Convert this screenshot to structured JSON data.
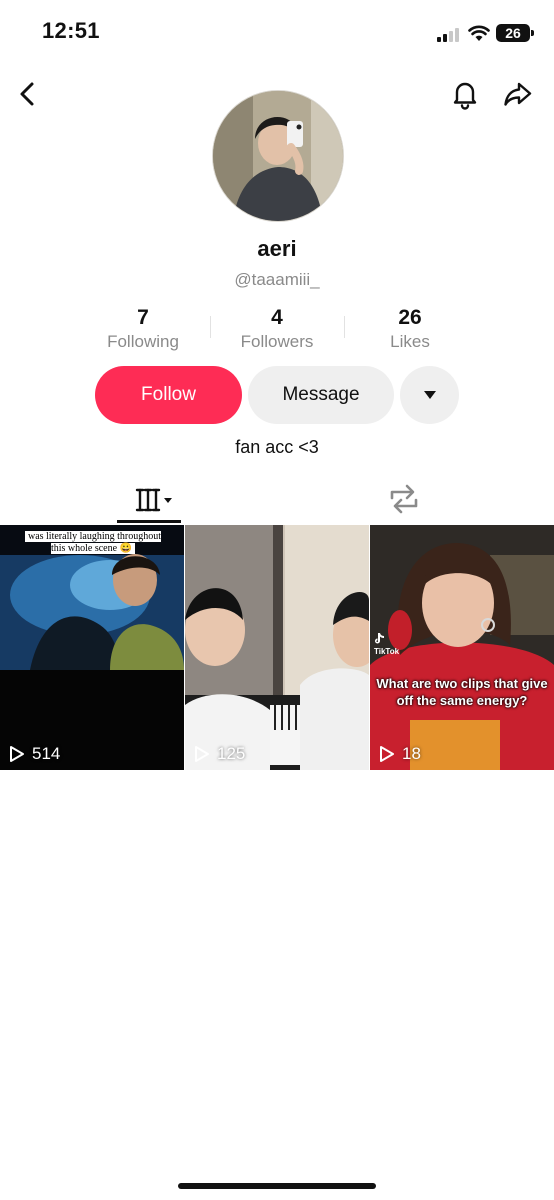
{
  "status_bar": {
    "time": "12:51",
    "battery": "26"
  },
  "profile": {
    "name": "aeri",
    "handle": "@taaamiii_",
    "bio": "fan acc <3",
    "stats": [
      {
        "value": "7",
        "label": "Following"
      },
      {
        "value": "4",
        "label": "Followers"
      },
      {
        "value": "26",
        "label": "Likes"
      }
    ]
  },
  "actions": {
    "follow": "Follow",
    "message": "Message"
  },
  "videos": [
    {
      "views": "514",
      "caption": "was literally laughing throughout this whole scene 😀"
    },
    {
      "views": "125"
    },
    {
      "views": "18",
      "caption": "What are two clips that give off the same energy?",
      "watermark": "TikTok"
    }
  ],
  "colors": {
    "accent": "#fe2c55",
    "button_gray": "#efefef",
    "secondary_text": "#8a8a8a"
  }
}
